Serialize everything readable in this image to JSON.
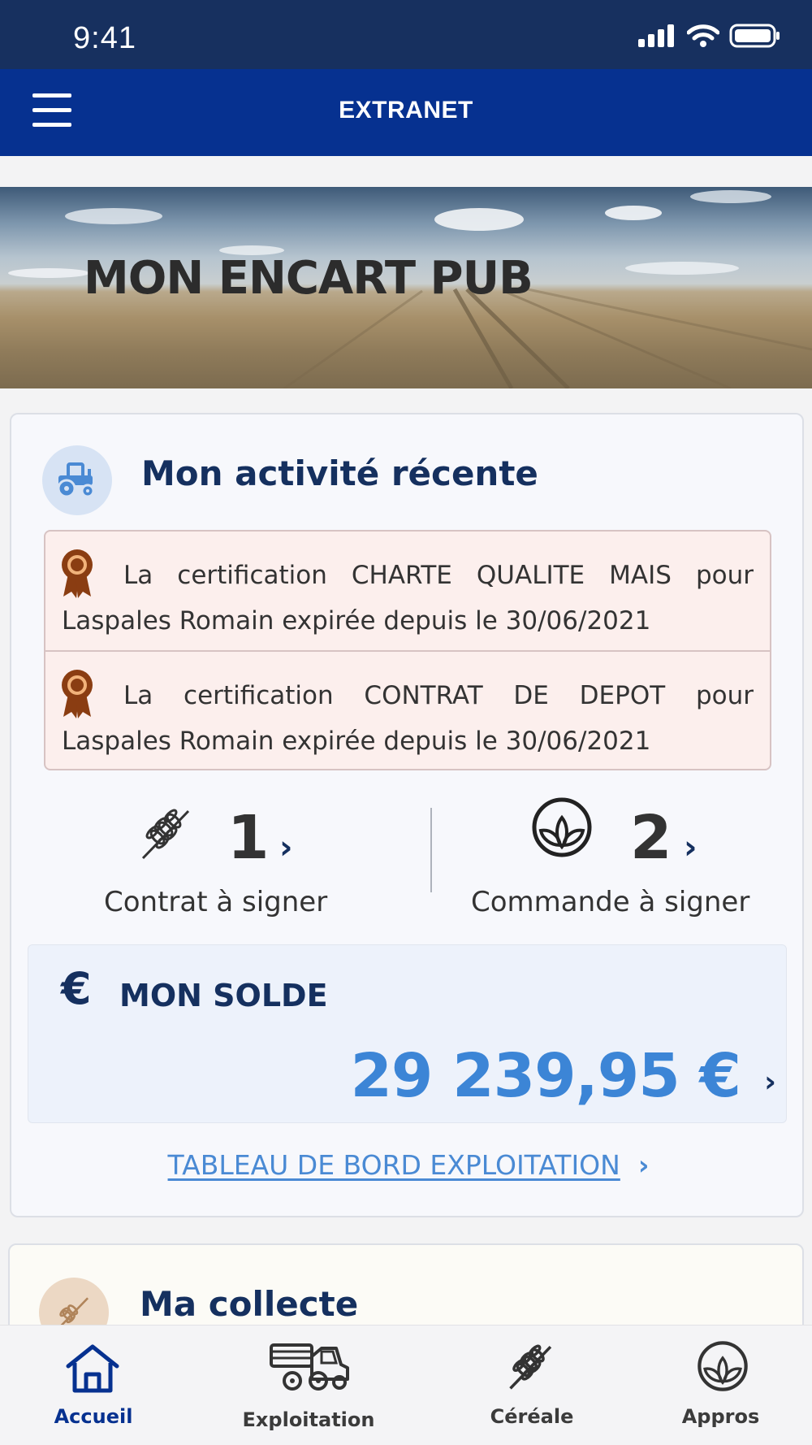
{
  "status_bar": {
    "time": "9:41",
    "icons": [
      "signal-icon",
      "wifi-icon",
      "battery-icon"
    ]
  },
  "nav": {
    "title": "EXTRANET",
    "menu_icon": "hamburger-menu-icon"
  },
  "banner": {
    "title": "MON ENCART PUB"
  },
  "activity": {
    "title": "Mon activité récente",
    "icon": "tractor-icon",
    "alerts": [
      {
        "icon": "award-ribbon-icon",
        "text": "La certification CHARTE QUALITE MAIS pour Laspales Romain expirée depuis le 30/06/2021"
      },
      {
        "icon": "award-ribbon-icon",
        "text": "La certification CONTRAT DE DEPOT pour Laspales Romain expirée depuis le 30/06/2021"
      }
    ],
    "stats": [
      {
        "icon": "wheat-icon",
        "count": "1",
        "label": "Contrat à signer"
      },
      {
        "icon": "plant-leaf-icon",
        "count": "2",
        "label": "Commande à signer"
      }
    ],
    "balance": {
      "currency_symbol": "€",
      "label": "MON SOLDE",
      "amount": "29 239,95 €"
    },
    "dashboard_link": "TABLEAU DE BORD EXPLOITATION"
  },
  "collecte": {
    "title": "Ma collecte",
    "icon": "wheat-icon"
  },
  "tabbar": {
    "items": [
      {
        "label": "Accueil",
        "icon": "home-icon",
        "active": true
      },
      {
        "label": "Exploitation",
        "icon": "harvester-icon",
        "active": false
      },
      {
        "label": "Céréale",
        "icon": "wheat-icon",
        "active": false
      },
      {
        "label": "Appros",
        "icon": "plant-leaf-icon",
        "active": false
      }
    ]
  },
  "colors": {
    "status_bar": "#17305f",
    "nav_bar": "#063190",
    "title_navy": "#15305f",
    "amount_blue": "#3c85d6",
    "alert_bg": "#fcefed",
    "award_brown": "#8a3d12"
  }
}
